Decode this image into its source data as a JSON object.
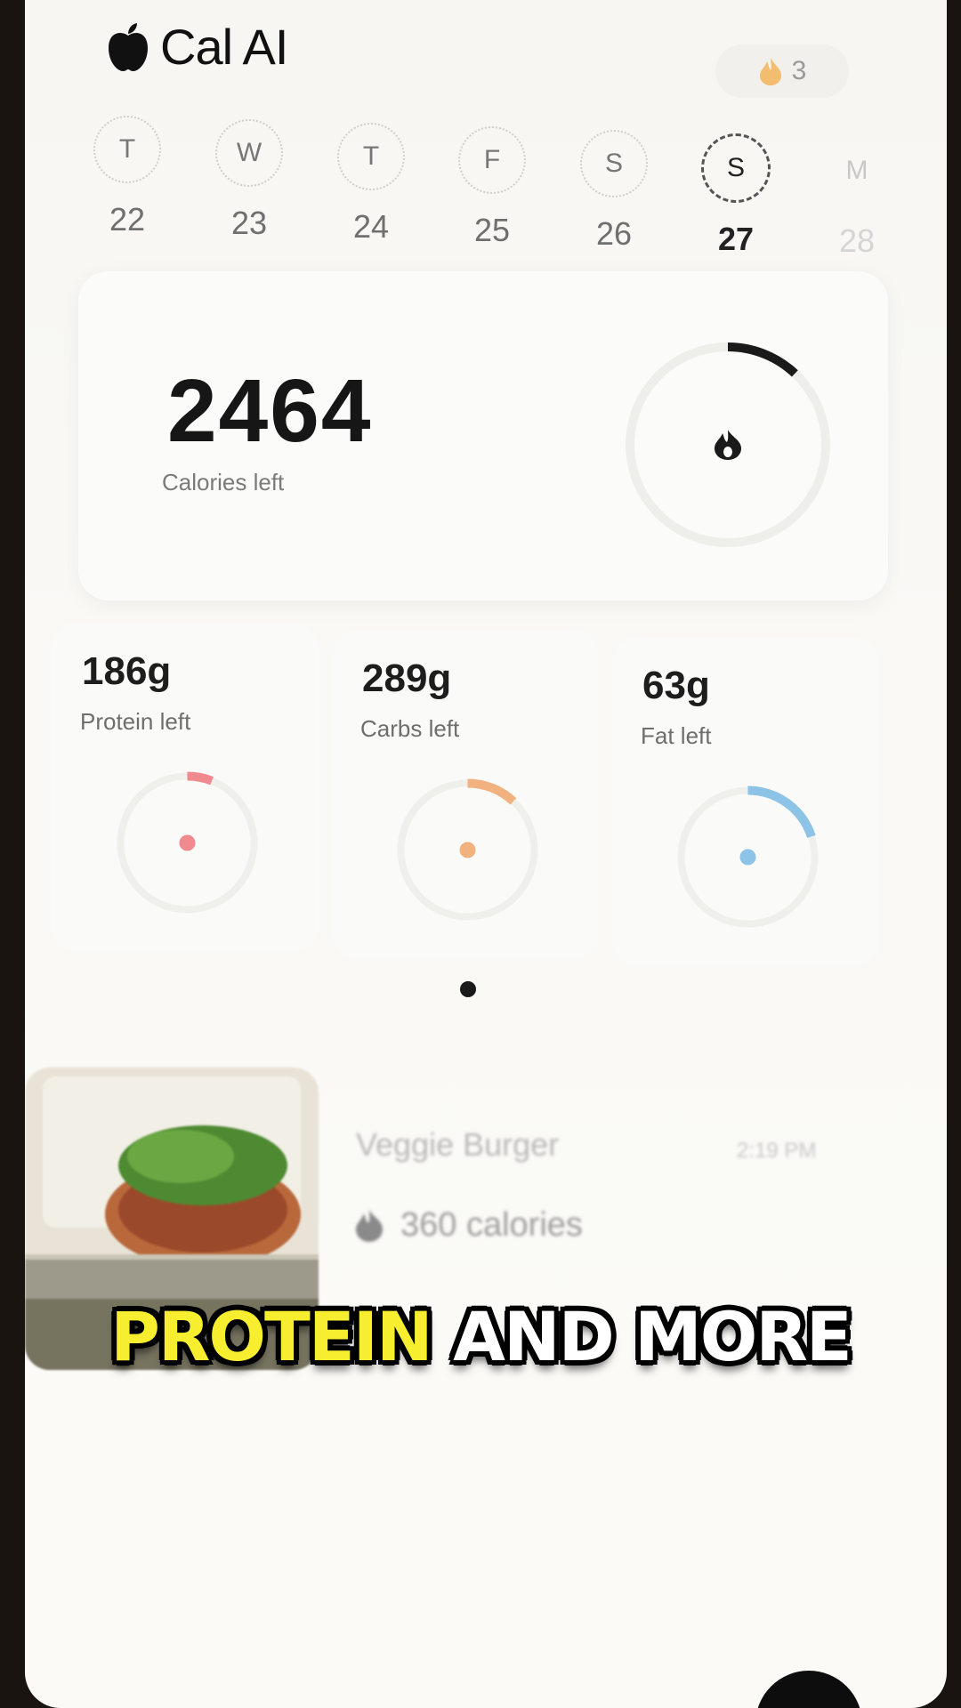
{
  "app": {
    "name": "Cal AI",
    "streak_count": "3"
  },
  "week": [
    {
      "letter": "T",
      "date": "22",
      "state": "past"
    },
    {
      "letter": "W",
      "date": "23",
      "state": "past"
    },
    {
      "letter": "T",
      "date": "24",
      "state": "past"
    },
    {
      "letter": "F",
      "date": "25",
      "state": "past"
    },
    {
      "letter": "S",
      "date": "26",
      "state": "past"
    },
    {
      "letter": "S",
      "date": "27",
      "state": "active"
    },
    {
      "letter": "M",
      "date": "28",
      "state": "future"
    }
  ],
  "calories": {
    "value": "2464",
    "label": "Calories left",
    "progress": 0.12
  },
  "macros": [
    {
      "amount": "186g",
      "label": "Protein left",
      "color": "#f08a8f",
      "progress": 0.06,
      "icon": "drumstick-icon"
    },
    {
      "amount": "289g",
      "label": "Carbs left",
      "color": "#f2b27f",
      "progress": 0.12,
      "icon": "wheat-icon"
    },
    {
      "amount": "63g",
      "label": "Fat left",
      "color": "#8cc3e6",
      "progress": 0.2,
      "icon": "droplet-icon"
    }
  ],
  "pager": {
    "active": 0
  },
  "meal": {
    "name": "Veggie Burger",
    "time": "2:19 PM",
    "calories": "360 calories"
  },
  "caption": {
    "highlight": "PROTEIN",
    "rest": "AND MORE"
  }
}
